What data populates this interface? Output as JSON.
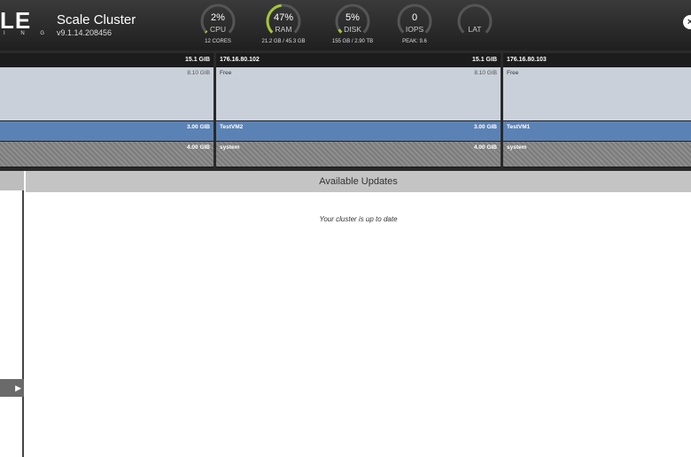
{
  "header": {
    "logo_text": "LE",
    "logo_sub": "I N G",
    "cluster_name": "Scale Cluster",
    "version": "v9.1.14.208456"
  },
  "gauges": [
    {
      "value": "2%",
      "label": "CPU",
      "sub": "12 CORES",
      "percent": 2
    },
    {
      "value": "47%",
      "label": "RAM",
      "sub": "21.2 GB / 45.3 GB",
      "percent": 47
    },
    {
      "value": "5%",
      "label": "DISK",
      "sub": "155 GB / 2.90 TB",
      "percent": 5
    },
    {
      "value": "0",
      "label": "IOPS",
      "sub": "PEAK: 9.6",
      "percent": 0
    },
    {
      "value": "",
      "label": "LAT",
      "sub": "",
      "percent": 0
    }
  ],
  "colors": {
    "gauge_track": "#555555",
    "gauge_fill": "#a4c639",
    "vm_blue": "#5b82b5",
    "free_gray": "#c9d0d9"
  },
  "nodes": [
    {
      "ip": "",
      "capacity": "15.1 GIB",
      "free_label": "",
      "free_amount": "8.10 GIB",
      "vm_name": "",
      "vm_amount": "3.00 GIB",
      "system_label": "",
      "system_amount": "4.00 GIB"
    },
    {
      "ip": "176.16.80.102",
      "capacity": "15.1 GIB",
      "free_label": "Free",
      "free_amount": "8.10 GIB",
      "vm_name": "TestVM2",
      "vm_amount": "3.00 GIB",
      "system_label": "system",
      "system_amount": "4.00 GIB"
    },
    {
      "ip": "176.16.80.103",
      "capacity": "",
      "free_label": "Free",
      "free_amount": "",
      "vm_name": "TestVM1",
      "vm_amount": "",
      "system_label": "system",
      "system_amount": ""
    }
  ],
  "updates": {
    "title": "Available Updates",
    "message": "Your cluster is up to date"
  },
  "expand_icon": "▶"
}
